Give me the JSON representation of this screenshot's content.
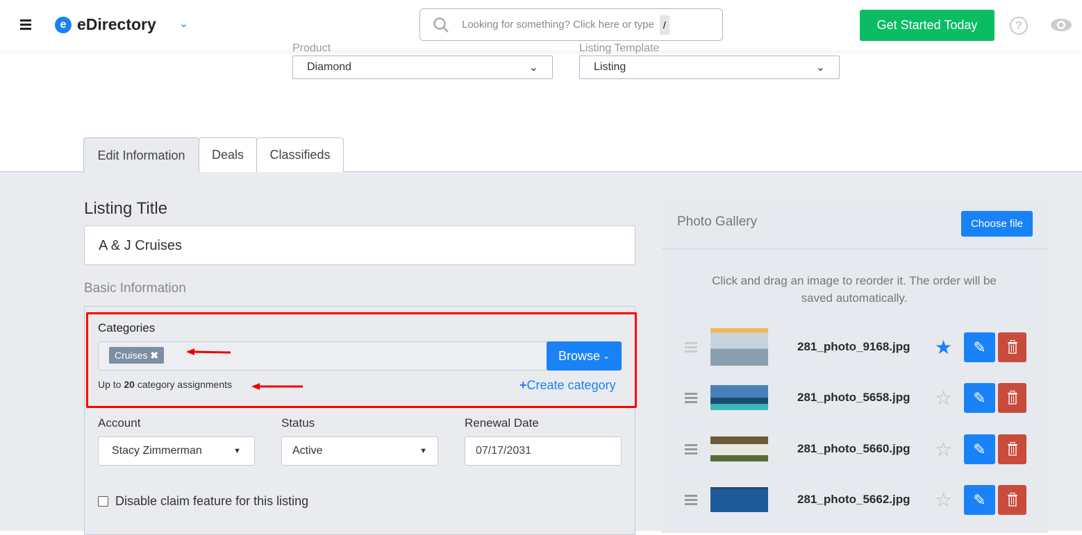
{
  "header": {
    "brand": "eDirectory",
    "search_placeholder": "Looking for something? Click here or type",
    "search_shortcut": "/",
    "cta": "Get Started Today"
  },
  "product": {
    "label": "Product",
    "value": "Diamond"
  },
  "template": {
    "label": "Listing Template",
    "value": "Listing"
  },
  "tabs": [
    {
      "label": "Edit Information"
    },
    {
      "label": "Deals"
    },
    {
      "label": "Classifieds"
    }
  ],
  "form": {
    "listing_title_label": "Listing Title",
    "listing_title_value": "A & J Cruises",
    "basic_info": "Basic Information",
    "categories_label": "Categories",
    "category_tag": "Cruises",
    "browse": "Browse",
    "limit_prefix": "Up to",
    "limit_count": "20",
    "limit_suffix": "category assignments",
    "create_category": "Create category",
    "account_label": "Account",
    "account_value": "Stacy Zimmerman",
    "status_label": "Status",
    "status_value": "Active",
    "renewal_label": "Renewal Date",
    "renewal_value": "07/17/2031",
    "claim_label": "Disable claim feature for this listing"
  },
  "gallery": {
    "title": "Photo Gallery",
    "choose": "Choose file",
    "hint": "Click and drag an image to reorder it. The order will be saved automatically.",
    "photos": [
      {
        "name": "281_photo_9168.jpg",
        "featured": true
      },
      {
        "name": "281_photo_5658.jpg",
        "featured": false
      },
      {
        "name": "281_photo_5660.jpg",
        "featured": false
      },
      {
        "name": "281_photo_5662.jpg",
        "featured": false
      }
    ]
  },
  "colors": {
    "accent": "#1a82f7",
    "cta": "#0bbd62",
    "danger": "#c84b3c",
    "highlight": "#ff0000"
  }
}
